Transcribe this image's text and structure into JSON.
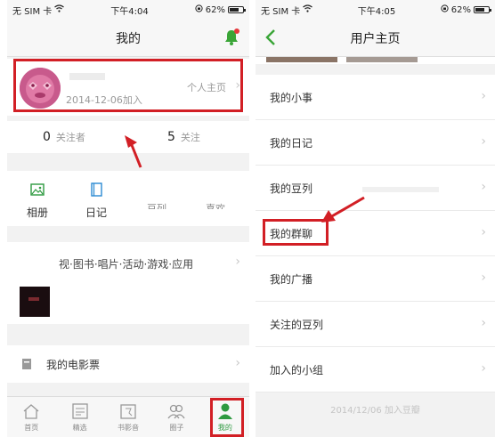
{
  "left_screen": {
    "status": {
      "carrier": "无 SIM 卡",
      "time": "下午4:04",
      "battery": "62%"
    },
    "title": "我的",
    "profile": {
      "joined": "2014-12-06加入",
      "homepage_label": "个人主页"
    },
    "follow": {
      "followers_count": "0",
      "followers_label": "关注者",
      "following_count": "5",
      "following_label": "关注"
    },
    "shortcuts": [
      {
        "label": "相册",
        "icon": "photo-album-icon"
      },
      {
        "label": "日记",
        "icon": "diary-book-icon"
      },
      {
        "label": "豆列"
      },
      {
        "label": "喜欢"
      }
    ],
    "media": {
      "title": "视·图书·唱片·活动·游戏·应用"
    },
    "tickets": {
      "label": "我的电影票"
    },
    "tabs": [
      {
        "label": "首页",
        "icon": "home-icon"
      },
      {
        "label": "精选",
        "icon": "featured-icon"
      },
      {
        "label": "书影音",
        "icon": "book-movie-music-icon"
      },
      {
        "label": "圈子",
        "icon": "circle-group-icon"
      },
      {
        "label": "我的",
        "icon": "profile-person-icon"
      }
    ],
    "accent": "#2e9a40",
    "highlight_color": "#d21f25"
  },
  "right_screen": {
    "status": {
      "carrier": "无 SIM 卡",
      "time": "下午4:05",
      "battery": "62%"
    },
    "title": "用户主页",
    "menu": [
      {
        "label": "我的小事"
      },
      {
        "label": "我的日记"
      },
      {
        "label": "我的豆列"
      },
      {
        "label": "我的群聊"
      },
      {
        "label": "我的广播"
      },
      {
        "label": "关注的豆列"
      },
      {
        "label": "加入的小组"
      }
    ],
    "footer": "2014/12/06 加入豆瓣"
  }
}
